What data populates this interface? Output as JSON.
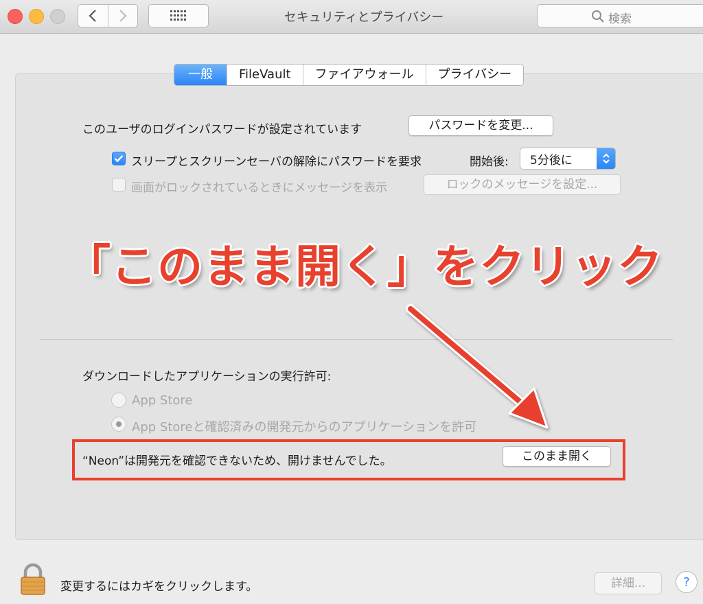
{
  "window": {
    "title": "セキュリティとプライバシー"
  },
  "search": {
    "placeholder": "検索"
  },
  "tabs": [
    "一般",
    "FileVault",
    "ファイアウォール",
    "プライバシー"
  ],
  "general": {
    "login_password_text": "このユーザのログインパスワードが設定されています",
    "change_password_button": "パスワードを変更...",
    "require_password_label": "スリープとスクリーンセーバの解除にパスワードを要求",
    "require_password_checked": true,
    "delay_label": "開始後:",
    "delay_value": "5分後に",
    "lock_message_label": "画面がロックされているときにメッセージを表示",
    "lock_message_checked": false,
    "lock_message_button": "ロックのメッセージを設定..."
  },
  "downloads": {
    "heading": "ダウンロードしたアプリケーションの実行許可:",
    "options": [
      {
        "label": "App Store",
        "selected": false
      },
      {
        "label": "App Storeと確認済みの開発元からのアプリケーションを許可",
        "selected": true
      }
    ],
    "blocked_message": "“Neon”は開発元を確認できないため、開けませんでした。",
    "open_anyway_button": "このまま開く"
  },
  "annotation": {
    "text": "「このまま開く」をクリック",
    "color": "#e8412d"
  },
  "footer": {
    "lock_text": "変更するにはカギをクリックします。",
    "advanced_button": "詳細...",
    "help_button": "?"
  },
  "colors": {
    "accent": "#2a86f5",
    "annotation_red": "#e8412d"
  },
  "icons": [
    "back-icon",
    "forward-icon",
    "grid-icon",
    "search-icon",
    "checkmark-icon",
    "updown-arrows-icon",
    "lock-icon",
    "help-icon"
  ]
}
